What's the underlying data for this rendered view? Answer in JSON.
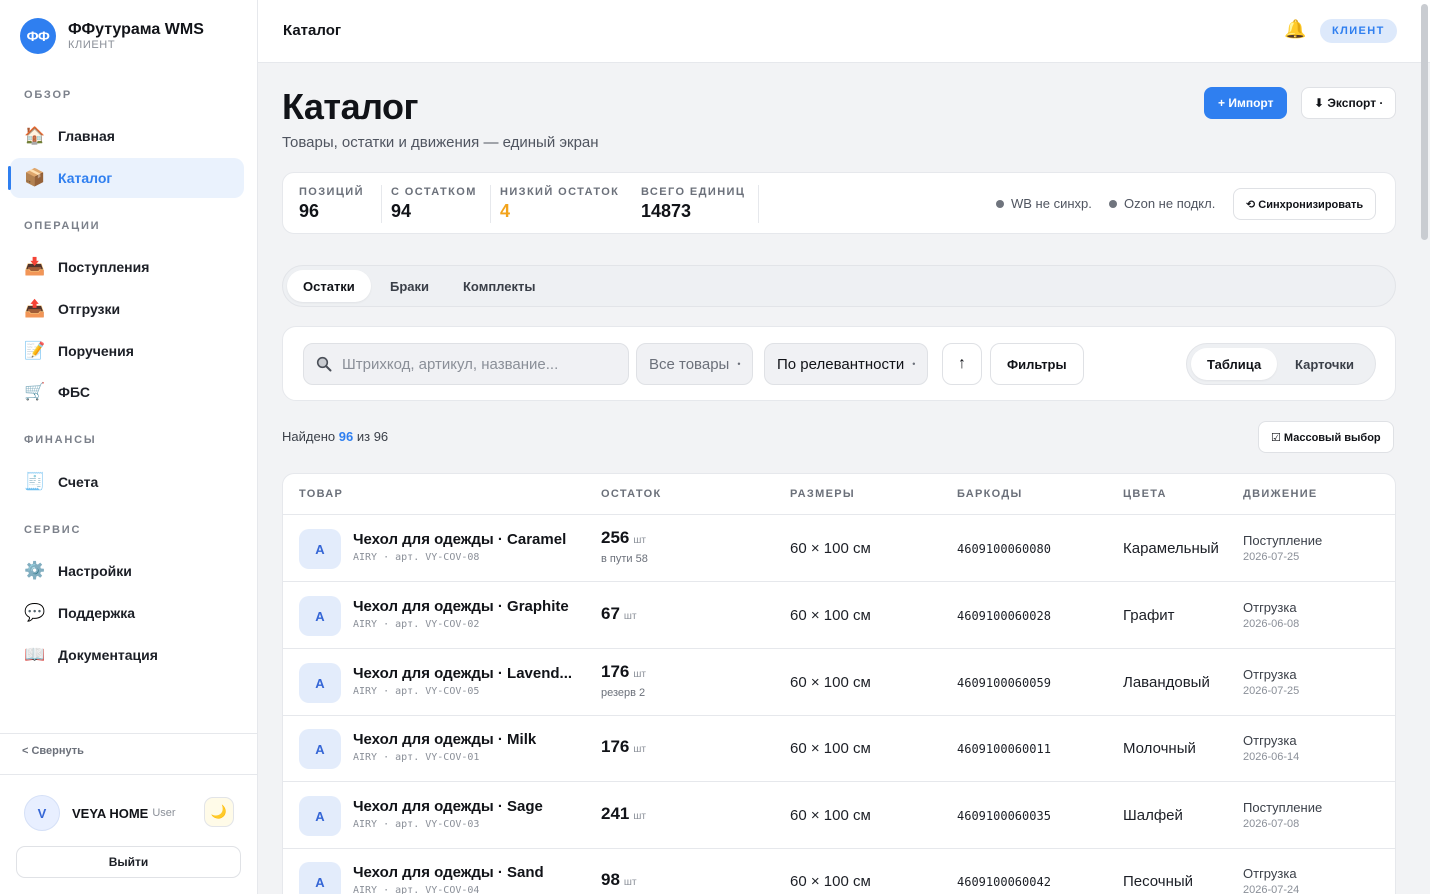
{
  "brand": {
    "logo": "ФФ",
    "name": "ФФутурама WMS",
    "sub": "КЛИЕНТ"
  },
  "nav": {
    "sections": [
      "ОБЗОР",
      "ОПЕРАЦИИ",
      "ФИНАНСЫ",
      "СЕРВИС"
    ],
    "items": [
      {
        "label": "Главная",
        "icon": "🏠"
      },
      {
        "label": "Каталог",
        "icon": "📦"
      },
      {
        "label": "Поступления",
        "icon": "📥"
      },
      {
        "label": "Отгрузки",
        "icon": "📤"
      },
      {
        "label": "Поручения",
        "icon": "📝"
      },
      {
        "label": "ФБС",
        "icon": "🛒"
      },
      {
        "label": "Счета",
        "icon": "🧾"
      },
      {
        "label": "Настройки",
        "icon": "⚙️"
      },
      {
        "label": "Поддержка",
        "icon": "💬"
      },
      {
        "label": "Документация",
        "icon": "📖"
      }
    ],
    "active_item": "Каталог"
  },
  "sidebar_footer": {
    "collapse": "< Свернуть",
    "user_initial": "V",
    "user_name": "VEYA HOME",
    "user_role": "User",
    "theme_icon": "🌙",
    "logout": "Выйти"
  },
  "topbar": {
    "title": "Каталог",
    "bell_icon": "🔔",
    "role": "КЛИЕНТ"
  },
  "page": {
    "title": "Каталог",
    "subtitle": "Товары, остатки и движения — единый экран",
    "import_label": "+  Импорт",
    "export_label": "⬇ Экспорт ·"
  },
  "stats": [
    {
      "label": "ПОЗИЦИЙ",
      "value": "96"
    },
    {
      "label": "С ОСТАТКОМ",
      "value": "94"
    },
    {
      "label": "НИЗКИЙ ОСТАТОК",
      "value": "4"
    },
    {
      "label": "ВСЕГО ЕДИНИЦ",
      "value": "14873"
    }
  ],
  "sync": {
    "wb": "WB не синхр.",
    "ozon": "Ozon не подкл.",
    "button": "⟲ Синхронизировать"
  },
  "tabs": [
    "Остатки",
    "Браки",
    "Комплекты"
  ],
  "active_tab": "Остатки",
  "filters": {
    "search_placeholder": "Штрихкод, артикул, название...",
    "search_value": "",
    "category": "Все товары",
    "sort": "По релевантности",
    "sort_dir": "↑",
    "filters_label": "Фильтры",
    "views": [
      "Таблица",
      "Карточки"
    ],
    "active_view": "Таблица"
  },
  "found": {
    "prefix": "Найдено",
    "count": "96",
    "middle": "из",
    "total": "96"
  },
  "mass_select": "☑ Массовый выбор",
  "table": {
    "columns": [
      "ТОВАР",
      "ОСТАТОК",
      "РАЗМЕРЫ",
      "БАРКОДЫ",
      "ЦВЕТА",
      "ДВИЖЕНИЕ"
    ],
    "rows": [
      {
        "thumb": "A",
        "name": "Чехол для одежды · Caramel",
        "sku": "AIRY · арт. VY-COV-08",
        "qty": "256",
        "unit": "шт",
        "note": "в пути 58",
        "size": "60 × 100 см",
        "barcode": "4609100060080",
        "color": "Карамельный",
        "move": "Поступление",
        "date": "2026-07-25"
      },
      {
        "thumb": "A",
        "name": "Чехол для одежды · Graphite",
        "sku": "AIRY · арт. VY-COV-02",
        "qty": "67",
        "unit": "шт",
        "note": "",
        "size": "60 × 100 см",
        "barcode": "4609100060028",
        "color": "Графит",
        "move": "Отгрузка",
        "date": "2026-06-08"
      },
      {
        "thumb": "A",
        "name": "Чехол для одежды · Lavend...",
        "sku": "AIRY · арт. VY-COV-05",
        "qty": "176",
        "unit": "шт",
        "note": "резерв 2",
        "size": "60 × 100 см",
        "barcode": "4609100060059",
        "color": "Лавандовый",
        "move": "Отгрузка",
        "date": "2026-07-25"
      },
      {
        "thumb": "A",
        "name": "Чехол для одежды · Milk",
        "sku": "AIRY · арт. VY-COV-01",
        "qty": "176",
        "unit": "шт",
        "note": "",
        "size": "60 × 100 см",
        "barcode": "4609100060011",
        "color": "Молочный",
        "move": "Отгрузка",
        "date": "2026-06-14"
      },
      {
        "thumb": "A",
        "name": "Чехол для одежды · Sage",
        "sku": "AIRY · арт. VY-COV-03",
        "qty": "241",
        "unit": "шт",
        "note": "",
        "size": "60 × 100 см",
        "barcode": "4609100060035",
        "color": "Шалфей",
        "move": "Поступление",
        "date": "2026-07-08"
      },
      {
        "thumb": "A",
        "name": "Чехол для одежды · Sand",
        "sku": "AIRY · арт. VY-COV-04",
        "qty": "98",
        "unit": "шт",
        "note": "",
        "size": "60 × 100 см",
        "barcode": "4609100060042",
        "color": "Песочный",
        "move": "Отгрузка",
        "date": "2026-07-24"
      }
    ]
  },
  "colors": {
    "accent": "#2f7ff0",
    "low_stock": "#f2a31b"
  }
}
